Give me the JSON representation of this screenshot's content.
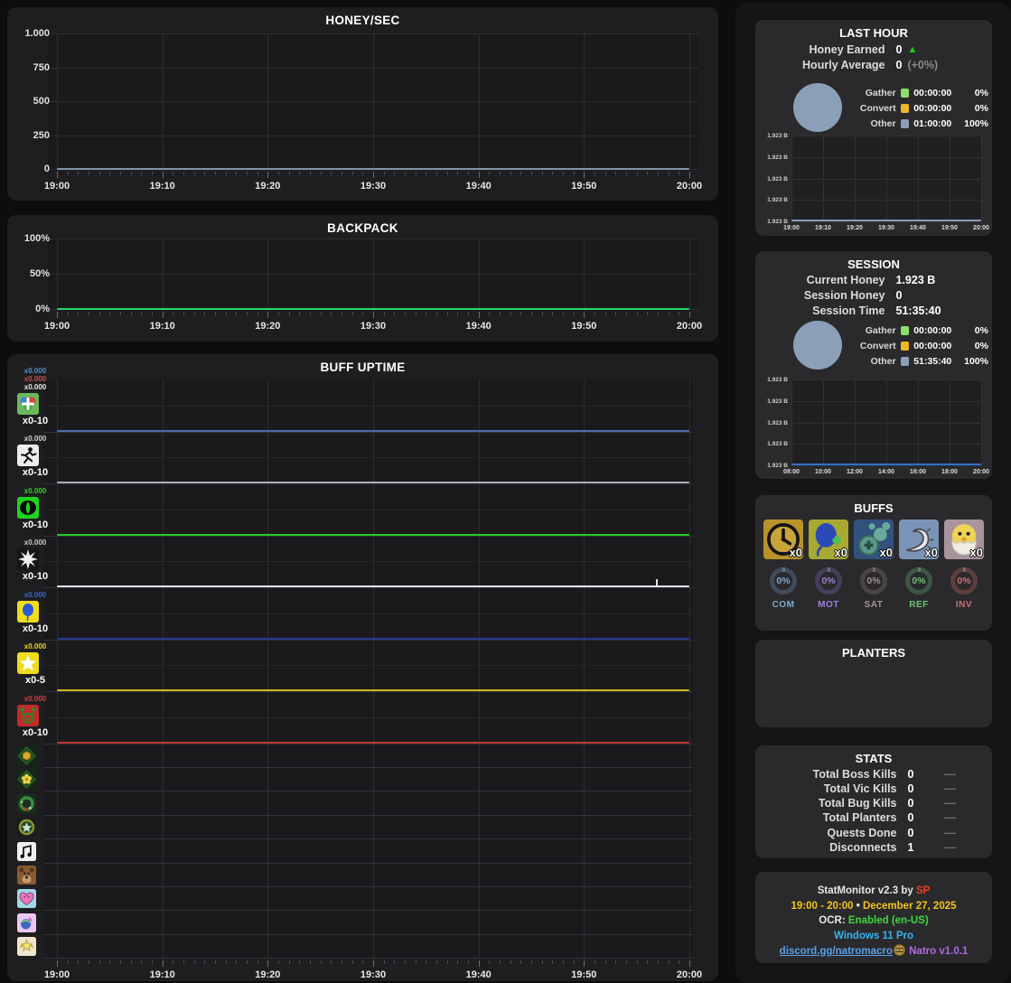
{
  "app": {
    "name": "StatMonitor"
  },
  "honeysec": {
    "title": "HONEY/SEC",
    "y_labels": [
      "1.000",
      "750",
      "500",
      "250",
      "0"
    ],
    "x_labels": [
      "19:00",
      "19:10",
      "19:20",
      "19:30",
      "19:40",
      "19:50",
      "20:00"
    ],
    "line_color": "#8095aa"
  },
  "backpack": {
    "title": "BACKPACK",
    "y_labels": [
      "100%",
      "50%",
      "0%"
    ],
    "x_labels": [
      "19:00",
      "19:10",
      "19:20",
      "19:30",
      "19:40",
      "19:50",
      "20:00"
    ],
    "line_color": "#2ad46a"
  },
  "buff_uptime": {
    "title": "BUFF UPTIME",
    "x_labels": [
      "19:00",
      "19:10",
      "19:20",
      "19:30",
      "19:40",
      "19:50",
      "20:00"
    ],
    "rows": [
      {
        "icon": "field-boosts-icon",
        "multipliers": [
          {
            "text": "x0.000",
            "color": "#4a8fd4"
          },
          {
            "text": "x0.000",
            "color": "#d44a4a"
          },
          {
            "text": "x0.000",
            "color": "#e8e8e8"
          }
        ],
        "range": "x0-10",
        "line_color": "#4a6da8",
        "tall": true
      },
      {
        "icon": "haste-runner-icon",
        "multipliers": [
          {
            "text": "x0.000",
            "color": "#d0d0d0"
          }
        ],
        "range": "x0-10",
        "line_color": "#a8adb5",
        "tall": true
      },
      {
        "icon": "focus-eye-icon",
        "multipliers": [
          {
            "text": "x0.000",
            "color": "#2ad42a"
          }
        ],
        "range": "x0-10",
        "line_color": "#28c828",
        "tall": true
      },
      {
        "icon": "pop-starburst-icon",
        "multipliers": [
          {
            "text": "x0.000",
            "color": "#c8c8c8"
          }
        ],
        "range": "x0-10",
        "line_color": "#e0e4e8",
        "tall": true,
        "spike": true
      },
      {
        "icon": "blue-balloon-icon",
        "multipliers": [
          {
            "text": "x0.000",
            "color": "#3a66d4"
          }
        ],
        "range": "x0-10",
        "line_color": "#28388f",
        "tall": true
      },
      {
        "icon": "white-star-icon",
        "multipliers": [
          {
            "text": "x0.000",
            "color": "#e8d21a"
          }
        ],
        "range": "x0-5",
        "line_color": "#c8ba18",
        "tall": true
      },
      {
        "icon": "reindeer-icon",
        "multipliers": [
          {
            "text": "x0.000",
            "color": "#e03a3a"
          }
        ],
        "range": "x0-10",
        "line_color": "#bf3535",
        "tall": true
      },
      {
        "icon": "honey-mask-icon",
        "tall": false
      },
      {
        "icon": "flower-mask-icon",
        "tall": false
      },
      {
        "icon": "wreath-icon",
        "tall": false
      },
      {
        "icon": "star-badge-icon",
        "tall": false
      },
      {
        "icon": "melody-icon",
        "tall": false
      },
      {
        "icon": "bear-morph-icon",
        "tall": false
      },
      {
        "icon": "smitten-heart-icon",
        "tall": false
      },
      {
        "icon": "gooey-icon",
        "tall": false
      },
      {
        "icon": "guiding-star-icon",
        "tall": false
      }
    ]
  },
  "last_hour": {
    "title": "LAST HOUR",
    "stats": [
      {
        "label": "Honey Earned",
        "value": "0",
        "extra": "▲",
        "extra_color": "#1ecc1e"
      },
      {
        "label": "Hourly Average",
        "value": "0",
        "extra": "(+0%)",
        "extra_color": "#8a8a8a"
      }
    ],
    "pie_color": "#8ba0b8",
    "legend": [
      {
        "label": "Gather",
        "color": "#8ede6a",
        "time": "00:00:00",
        "pct": "0%"
      },
      {
        "label": "Convert",
        "color": "#f0b429",
        "time": "00:00:00",
        "pct": "0%"
      },
      {
        "label": "Other",
        "color": "#8ba0b8",
        "time": "01:00:00",
        "pct": "100%"
      }
    ],
    "chart": {
      "y_labels": [
        "1.923 B",
        "1.923 B",
        "1.923 B",
        "1.923 B",
        "1.923 B"
      ],
      "x_labels": [
        "19:00",
        "19:10",
        "19:20",
        "19:30",
        "19:40",
        "19:50",
        "20:00"
      ],
      "line_color": "#8ba0b8"
    }
  },
  "session": {
    "title": "SESSION",
    "stats": [
      {
        "label": "Current Honey",
        "value": "1.923 B"
      },
      {
        "label": "Session Honey",
        "value": "0"
      },
      {
        "label": "Session Time",
        "value": "51:35:40"
      }
    ],
    "pie_color": "#8ba0b8",
    "legend": [
      {
        "label": "Gather",
        "color": "#8ede6a",
        "time": "00:00:00",
        "pct": "0%"
      },
      {
        "label": "Convert",
        "color": "#f0b429",
        "time": "00:00:00",
        "pct": "0%"
      },
      {
        "label": "Other",
        "color": "#8ba0b8",
        "time": "51:35:40",
        "pct": "100%"
      }
    ],
    "chart": {
      "y_labels": [
        "1.923 B",
        "1.923 B",
        "1.923 B",
        "1.923 B",
        "1.923 B"
      ],
      "x_labels": [
        "08:00",
        "10:00",
        "12:00",
        "14:00",
        "16:00",
        "18:00",
        "20:00"
      ],
      "line_color": "#2f72cc"
    }
  },
  "buffs": {
    "title": "BUFFS",
    "items": [
      {
        "icon": "clock-buff-icon",
        "mult": "x0"
      },
      {
        "icon": "balloon-buff-icon",
        "mult": "x0"
      },
      {
        "icon": "bubbles-buff-icon",
        "mult": "x0"
      },
      {
        "icon": "wave-buff-icon",
        "mult": "x0"
      },
      {
        "icon": "chick-buff-icon",
        "mult": "x0"
      }
    ],
    "gauges": [
      {
        "label": "COM",
        "value": "0%",
        "ring": "#3e4c5c",
        "color": "#7fa8cc"
      },
      {
        "label": "MOT",
        "value": "0%",
        "ring": "#473e5c",
        "color": "#9d82d8"
      },
      {
        "label": "SAT",
        "value": "0%",
        "ring": "#4c4444",
        "color": "#a89090"
      },
      {
        "label": "REF",
        "value": "0%",
        "ring": "#3e5645",
        "color": "#72c472"
      },
      {
        "label": "INV",
        "value": "0%",
        "ring": "#5c3e3e",
        "color": "#cc7070"
      }
    ]
  },
  "planters": {
    "title": "PLANTERS"
  },
  "stats_panel": {
    "title": "STATS",
    "rows": [
      {
        "label": "Total Boss Kills",
        "value": "0",
        "dash": "—"
      },
      {
        "label": "Total Vic Kills",
        "value": "0",
        "dash": "—"
      },
      {
        "label": "Total Bug Kills",
        "value": "0",
        "dash": "—"
      },
      {
        "label": "Total Planters",
        "value": "0",
        "dash": "—"
      },
      {
        "label": "Quests Done",
        "value": "0",
        "dash": "—"
      },
      {
        "label": "Disconnects",
        "value": "1",
        "dash": "—"
      }
    ]
  },
  "footer": {
    "line1": [
      {
        "text": "StatMonitor v2.3 by ",
        "color": "#e8e8e8"
      },
      {
        "text": "SP",
        "color": "#f04020"
      }
    ],
    "line2": [
      {
        "text": "19:00 - 20:00",
        "color": "#f2c41d"
      },
      {
        "text": " • ",
        "color": "#f0f0f0"
      },
      {
        "text": "December 27, 2025",
        "color": "#f2c41d"
      }
    ],
    "line3": [
      {
        "text": "OCR: ",
        "color": "#e8e8e8"
      },
      {
        "text": "Enabled (en-US)",
        "color": "#3fd83f"
      }
    ],
    "line4": [
      {
        "text": "Windows 11 Pro",
        "color": "#35b3ef"
      }
    ],
    "link_text": "discord.gg/natromacro",
    "link_color": "#5aa0e8",
    "version_text": "Natro v1.0.1",
    "version_color": "#b06ae0"
  },
  "chart_data": [
    {
      "type": "line",
      "title": "HONEY/SEC",
      "x_range": [
        "19:00",
        "20:00"
      ],
      "ylim": [
        0,
        1000
      ],
      "y_ticks": [
        "1.000",
        "750",
        "500",
        "250",
        "0"
      ],
      "series": [
        {
          "name": "honey/sec",
          "constant_value": 0
        }
      ],
      "grid": true
    },
    {
      "type": "line",
      "title": "BACKPACK",
      "x_range": [
        "19:00",
        "20:00"
      ],
      "ylim": [
        0,
        100
      ],
      "y_ticks": [
        "100%",
        "50%",
        "0%"
      ],
      "series": [
        {
          "name": "backpack %",
          "constant_value": 0
        }
      ],
      "grid": true
    },
    {
      "type": "line",
      "title": "BUFF UPTIME",
      "x_range": [
        "19:00",
        "20:00"
      ],
      "series": [
        {
          "name": "field-boosts",
          "constant_value": 0
        },
        {
          "name": "haste",
          "constant_value": 0
        },
        {
          "name": "focus",
          "constant_value": 0
        },
        {
          "name": "pop-star",
          "constant_value": 0,
          "note": "single tiny spike near 19:57"
        },
        {
          "name": "blue-balloon",
          "constant_value": 0
        },
        {
          "name": "star",
          "constant_value": 0
        },
        {
          "name": "reindeer",
          "constant_value": 0
        }
      ],
      "grid": true
    },
    {
      "type": "line",
      "title": "LAST HOUR honey",
      "x_range": [
        "19:00",
        "20:00"
      ],
      "y_ticks": [
        "1.923 B"
      ],
      "series": [
        {
          "name": "honey",
          "constant_value": "1.923 B"
        }
      ]
    },
    {
      "type": "line",
      "title": "SESSION honey",
      "x_range": [
        "08:00",
        "20:00"
      ],
      "y_ticks": [
        "1.923 B"
      ],
      "series": [
        {
          "name": "honey",
          "constant_value": "1.923 B"
        }
      ]
    },
    {
      "type": "pie",
      "title": "LAST HOUR activity",
      "slices": [
        {
          "label": "Gather",
          "value": 0
        },
        {
          "label": "Convert",
          "value": 0
        },
        {
          "label": "Other",
          "value": 100
        }
      ]
    },
    {
      "type": "pie",
      "title": "SESSION activity",
      "slices": [
        {
          "label": "Gather",
          "value": 0
        },
        {
          "label": "Convert",
          "value": 0
        },
        {
          "label": "Other",
          "value": 100
        }
      ]
    }
  ]
}
